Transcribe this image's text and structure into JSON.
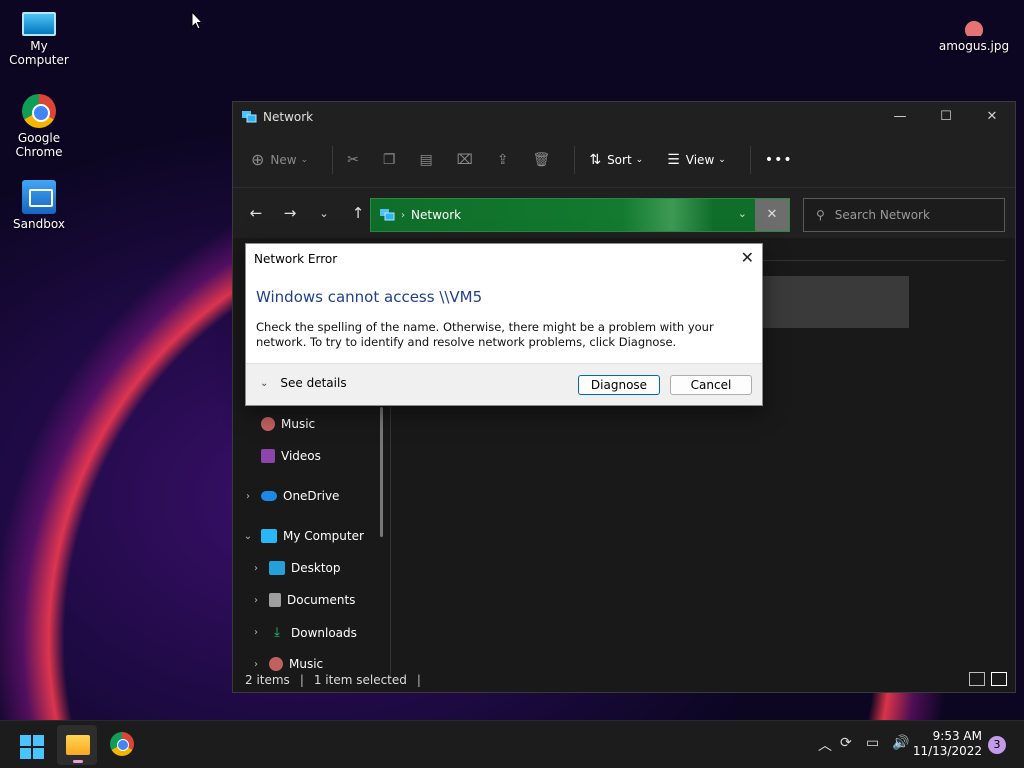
{
  "desktop": {
    "icons": [
      {
        "label": "My Computer"
      },
      {
        "label": "Google Chrome"
      },
      {
        "label": "Sandbox"
      },
      {
        "label": "amogus.jpg"
      }
    ]
  },
  "explorer": {
    "title": "Network",
    "toolbar": {
      "new_label": "New",
      "sort_label": "Sort",
      "view_label": "View",
      "more_label": "•••"
    },
    "address": {
      "crumb": "Network"
    },
    "search": {
      "placeholder": "Search Network"
    },
    "sidebar": {
      "items": [
        {
          "label": "Music",
          "icon": "music-icon"
        },
        {
          "label": "Videos",
          "icon": "videos-icon"
        },
        {
          "label": "OneDrive",
          "icon": "cloud-icon"
        },
        {
          "label": "My Computer",
          "icon": "computer-icon"
        },
        {
          "label": "Desktop",
          "icon": "desktop-icon"
        },
        {
          "label": "Documents",
          "icon": "documents-icon"
        },
        {
          "label": "Downloads",
          "icon": "download-icon"
        },
        {
          "label": "Music",
          "icon": "music-icon"
        }
      ]
    },
    "status": {
      "items": "2 items",
      "selected": "1 item selected"
    }
  },
  "dialog": {
    "title": "Network Error",
    "heading": "Windows cannot access \\\\VM5",
    "message": "Check the spelling of the name. Otherwise, there might be a problem with your network. To try to identify and resolve network problems, click Diagnose.",
    "see_details": "See details",
    "diagnose_label": "Diagnose",
    "cancel_label": "Cancel"
  },
  "taskbar": {
    "time": "9:53 AM",
    "date": "11/13/2022",
    "notifications": "3"
  },
  "colors": {
    "address_bar": "#137a2f",
    "dialog_heading": "#1f3f8f",
    "accent": "#4cc2ff"
  }
}
